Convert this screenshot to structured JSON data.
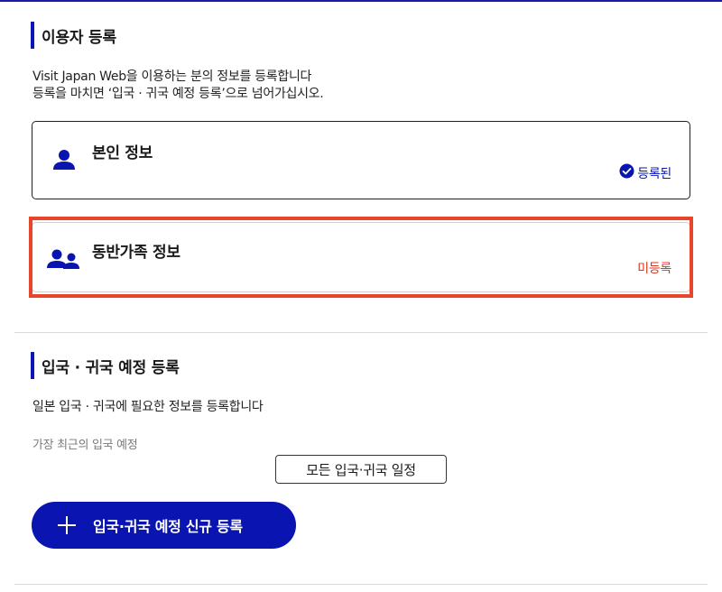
{
  "registration": {
    "title": "이용자 등록",
    "desc_line1": "Visit Japan Web을 이용하는 분의 정보를 등록합니다",
    "desc_line2": "등록을 마치면 ‘입국 · 귀국 예정 등록’으로 넘어가십시오.",
    "self_card": {
      "title": "본인 정보",
      "status": "등록된",
      "status_color": "#0a14b0",
      "icon": "person-icon"
    },
    "family_card": {
      "title": "동반가족 정보",
      "status": "미등록",
      "status_color": "#d9361f",
      "icon": "people-icon"
    }
  },
  "schedule": {
    "title": "입국 · 귀국 예정 등록",
    "desc": "일본 입국 · 귀국에 필요한 정보를 등록합니다",
    "recent_label": "가장 최근의 입국 예정",
    "all_button": "모든 입국·귀국 일정",
    "new_button": "입국·귀국 예정 신규 등록"
  },
  "colors": {
    "accent": "#0a14b0",
    "highlight": "#e8452b"
  }
}
